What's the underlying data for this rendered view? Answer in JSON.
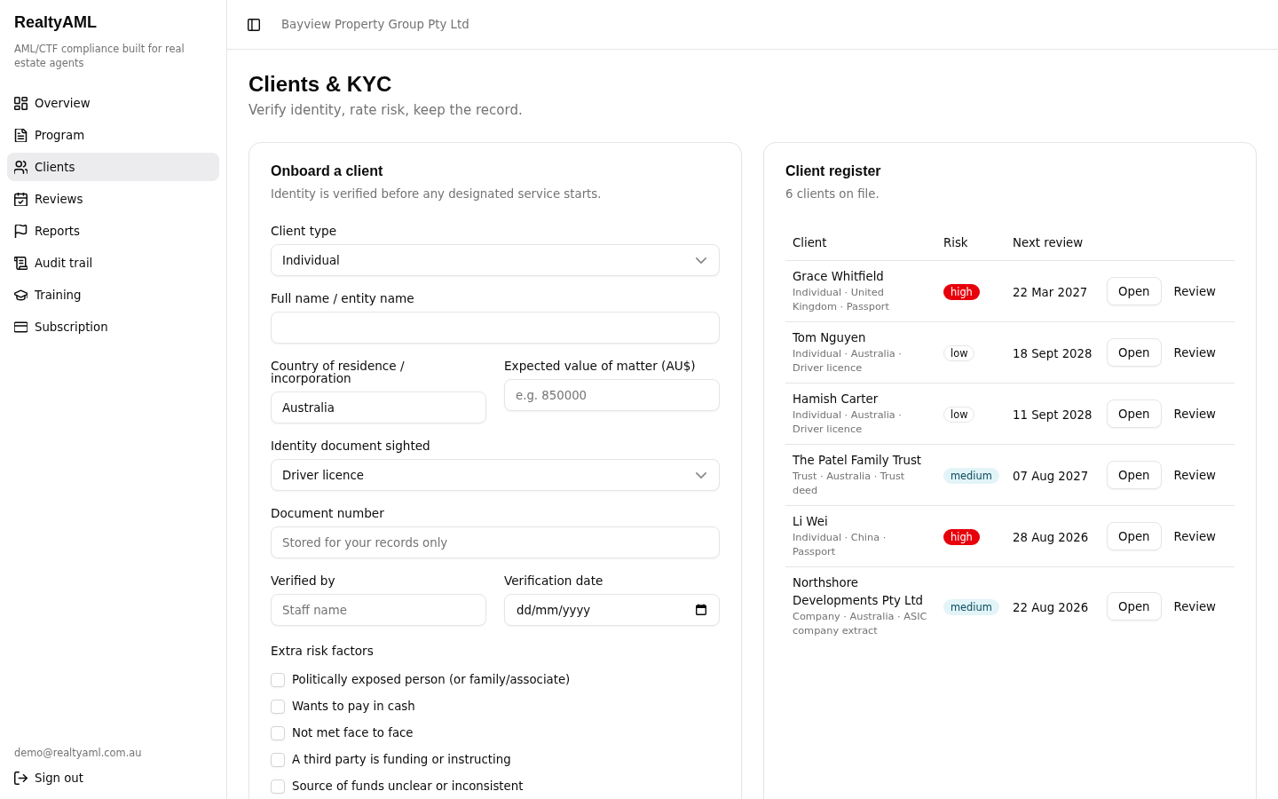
{
  "sidebar": {
    "brand": "RealtyAML",
    "tagline": "AML/CTF compliance built for real estate agents",
    "items": [
      {
        "label": "Overview",
        "selected": false
      },
      {
        "label": "Program",
        "selected": false
      },
      {
        "label": "Clients",
        "selected": true
      },
      {
        "label": "Reviews",
        "selected": false
      },
      {
        "label": "Reports",
        "selected": false
      },
      {
        "label": "Audit trail",
        "selected": false
      },
      {
        "label": "Training",
        "selected": false
      },
      {
        "label": "Subscription",
        "selected": false
      }
    ],
    "account": {
      "email": "demo@realtyaml.com.au",
      "sign_out": "Sign out"
    }
  },
  "topbar": {
    "organisation": "Bayview Property Group Pty Ltd"
  },
  "page": {
    "title": "Clients & KYC",
    "subtitle": "Verify identity, rate risk, keep the record."
  },
  "onboard": {
    "title": "Onboard a client",
    "subtitle": "Identity is verified before any designated service starts.",
    "rows": [
      {
        "fields": [
          {
            "kind": "select",
            "label": "Client type",
            "value": "Individual"
          }
        ]
      },
      {
        "fields": [
          {
            "kind": "text",
            "label": "Full name / entity name"
          }
        ]
      },
      {
        "fields": [
          {
            "kind": "text",
            "label": "Country of residence / incorporation",
            "value": "Australia"
          },
          {
            "kind": "text",
            "label": "Expected value of matter (AU$)",
            "placeholder": "e.g. 850000"
          }
        ]
      },
      {
        "fields": [
          {
            "kind": "select",
            "label": "Identity document sighted",
            "value": "Driver licence"
          }
        ]
      },
      {
        "fields": [
          {
            "kind": "text",
            "label": "Document number",
            "placeholder": "Stored for your records only"
          }
        ]
      },
      {
        "fields": [
          {
            "kind": "text",
            "label": "Verified by",
            "placeholder": "Staff name"
          },
          {
            "kind": "date",
            "label": "Verification date",
            "placeholder": "dd/mm/yyyy"
          }
        ]
      }
    ],
    "risk_factors": {
      "label": "Extra risk factors",
      "items": [
        {
          "label": "Politically exposed person (or family/associate)",
          "checked": false
        },
        {
          "label": "Wants to pay in cash",
          "checked": false
        },
        {
          "label": "Not met face to face",
          "checked": false
        },
        {
          "label": "A third party is funding or instructing",
          "checked": false
        },
        {
          "label": "Source of funds unclear or inconsistent",
          "checked": false
        }
      ]
    }
  },
  "register": {
    "title": "Client register",
    "subtitle": "6 clients on file.",
    "columns": [
      "Client",
      "Risk",
      "Next review"
    ],
    "rows": [
      {
        "name": "Grace Whitfield",
        "details": "Individual · United Kingdom · Passport",
        "risk": {
          "label": "high",
          "kind": "high"
        },
        "next_review": "22 Mar 2027",
        "actions": [
          {
            "label": "Open",
            "kind": "outline"
          },
          {
            "label": "Review",
            "kind": "ghost"
          }
        ]
      },
      {
        "name": "Tom Nguyen",
        "details": "Individual · Australia · Driver licence",
        "risk": {
          "label": "low",
          "kind": "low"
        },
        "next_review": "18 Sept 2028",
        "actions": [
          {
            "label": "Open",
            "kind": "outline"
          },
          {
            "label": "Review",
            "kind": "ghost"
          }
        ]
      },
      {
        "name": "Hamish Carter",
        "details": "Individual · Australia · Driver licence",
        "risk": {
          "label": "low",
          "kind": "low"
        },
        "next_review": "11 Sept 2028",
        "actions": [
          {
            "label": "Open",
            "kind": "outline"
          },
          {
            "label": "Review",
            "kind": "ghost"
          }
        ]
      },
      {
        "name": "The Patel Family Trust",
        "details": "Trust · Australia · Trust deed",
        "risk": {
          "label": "medium",
          "kind": "medium"
        },
        "next_review": "07 Aug 2027",
        "actions": [
          {
            "label": "Open",
            "kind": "outline"
          },
          {
            "label": "Review",
            "kind": "ghost"
          }
        ]
      },
      {
        "name": "Li Wei",
        "details": "Individual · China · Passport",
        "risk": {
          "label": "high",
          "kind": "high"
        },
        "next_review": "28 Aug 2026",
        "actions": [
          {
            "label": "Open",
            "kind": "outline"
          },
          {
            "label": "Review",
            "kind": "ghost"
          }
        ]
      },
      {
        "name": "Northshore Developments Pty Ltd",
        "details": "Company · Australia · ASIC company extract",
        "risk": {
          "label": "medium",
          "kind": "medium"
        },
        "next_review": "22 Aug 2026",
        "actions": [
          {
            "label": "Open",
            "kind": "outline"
          },
          {
            "label": "Review",
            "kind": "ghost"
          }
        ]
      }
    ]
  }
}
